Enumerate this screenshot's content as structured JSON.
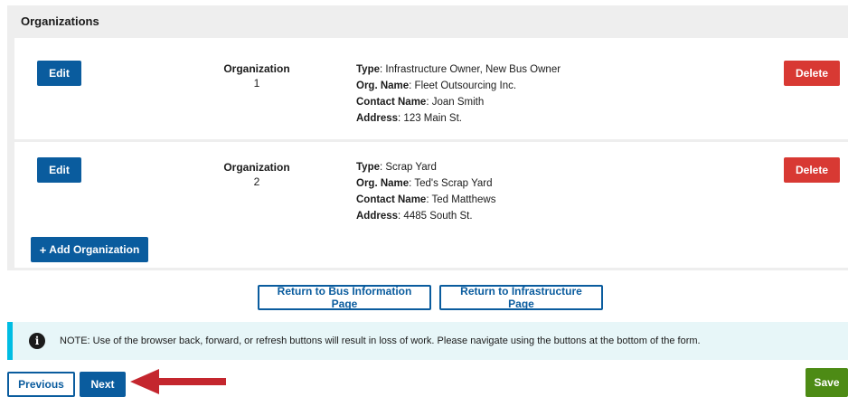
{
  "panel": {
    "title": "Organizations"
  },
  "organizations": [
    {
      "edit_label": "Edit",
      "delete_label": "Delete",
      "label": "Organization",
      "number": "1",
      "type_key": "Type",
      "type": ": Infrastructure Owner, New Bus Owner",
      "org_name_key": "Org. Name",
      "org_name": ": Fleet Outsourcing Inc.",
      "contact_key": "Contact Name",
      "contact": ": Joan Smith",
      "address_key": "Address",
      "address": ": 123 Main St."
    },
    {
      "edit_label": "Edit",
      "delete_label": "Delete",
      "label": "Organization",
      "number": "2",
      "type_key": "Type",
      "type": ": Scrap Yard",
      "org_name_key": "Org. Name",
      "org_name": ": Ted's Scrap Yard",
      "contact_key": "Contact Name",
      "contact": ": Ted Matthews",
      "address_key": "Address",
      "address": ": 4485 South St."
    }
  ],
  "add_button": {
    "plus": "+",
    "label": "Add Organization"
  },
  "return_buttons": {
    "bus": "Return to Bus Information Page",
    "infrastructure": "Return to Infrastructure Page"
  },
  "notice": {
    "icon": "info-icon",
    "icon_glyph": "i",
    "text": "NOTE: Use of the browser back, forward, or refresh buttons will result in loss of work. Please navigate using the buttons at the bottom of the form."
  },
  "nav": {
    "previous": "Previous",
    "next": "Next",
    "save": "Save"
  },
  "colors": {
    "primary": "#0a5c9e",
    "danger": "#d83933",
    "success": "#4d8b15",
    "notice_bg": "#e7f6f8",
    "notice_border": "#00bde3",
    "arrow": "#c4262e"
  }
}
